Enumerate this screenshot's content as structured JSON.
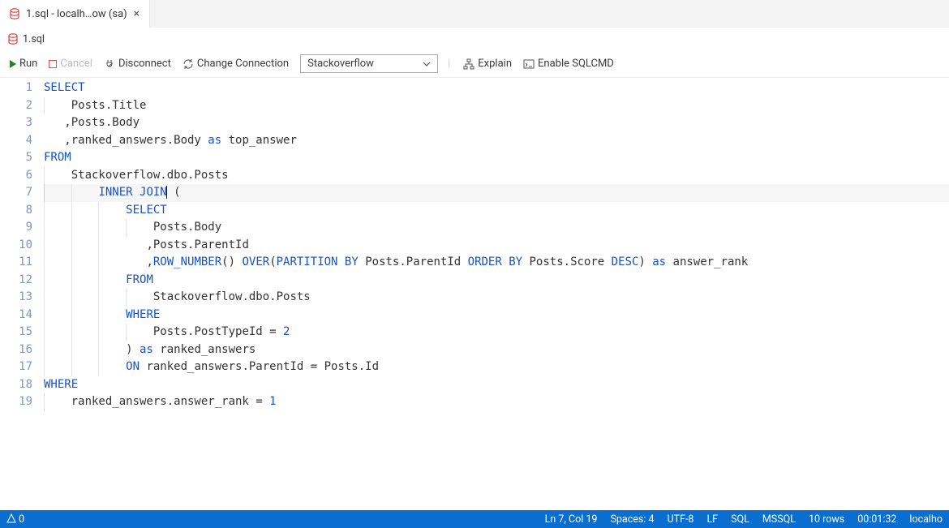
{
  "tab": {
    "title": "1.sql - localh…ow (sa)",
    "close": "×"
  },
  "subtab": {
    "title": "1.sql"
  },
  "toolbar": {
    "run": "Run",
    "cancel": "Cancel",
    "disconnect": "Disconnect",
    "change_conn": "Change Connection",
    "db_selected": "Stackoverflow",
    "explain": "Explain",
    "sqlcmd": "Enable SQLCMD"
  },
  "code": {
    "lines": [
      {
        "n": "1",
        "segs": [
          [
            "kw",
            "SELECT"
          ]
        ]
      },
      {
        "n": "2",
        "segs": [
          [
            "plain",
            "    Posts.Title"
          ]
        ]
      },
      {
        "n": "3",
        "segs": [
          [
            "plain",
            "   ,Posts.Body"
          ]
        ]
      },
      {
        "n": "4",
        "segs": [
          [
            "plain",
            "   ,ranked_answers.Body "
          ],
          [
            "kw",
            "as"
          ],
          [
            "plain",
            " top_answer"
          ]
        ]
      },
      {
        "n": "5",
        "segs": [
          [
            "kw",
            "FROM"
          ]
        ]
      },
      {
        "n": "6",
        "segs": [
          [
            "plain",
            "    Stackoverflow.dbo.Posts"
          ]
        ]
      },
      {
        "n": "7",
        "segs": [
          [
            "plain",
            "        "
          ],
          [
            "kw",
            "INNER JOIN"
          ],
          [
            "plain",
            " ("
          ]
        ],
        "current": true,
        "cursor_after": 2
      },
      {
        "n": "8",
        "segs": [
          [
            "plain",
            "            "
          ],
          [
            "kw",
            "SELECT"
          ]
        ]
      },
      {
        "n": "9",
        "segs": [
          [
            "plain",
            "                Posts.Body"
          ]
        ]
      },
      {
        "n": "10",
        "segs": [
          [
            "plain",
            "               ,Posts.ParentId"
          ]
        ]
      },
      {
        "n": "11",
        "segs": [
          [
            "plain",
            "               ,"
          ],
          [
            "kw",
            "ROW_NUMBER"
          ],
          [
            "plain",
            "() "
          ],
          [
            "kw",
            "OVER"
          ],
          [
            "plain",
            "("
          ],
          [
            "kw",
            "PARTITION BY"
          ],
          [
            "plain",
            " Posts.ParentId "
          ],
          [
            "kw",
            "ORDER BY"
          ],
          [
            "plain",
            " Posts.Score "
          ],
          [
            "kw",
            "DESC"
          ],
          [
            "plain",
            ") "
          ],
          [
            "kw",
            "as"
          ],
          [
            "plain",
            " answer_rank"
          ]
        ]
      },
      {
        "n": "12",
        "segs": [
          [
            "plain",
            "            "
          ],
          [
            "kw",
            "FROM"
          ]
        ]
      },
      {
        "n": "13",
        "segs": [
          [
            "plain",
            "                Stackoverflow.dbo.Posts"
          ]
        ]
      },
      {
        "n": "14",
        "segs": [
          [
            "plain",
            "            "
          ],
          [
            "kw",
            "WHERE"
          ]
        ]
      },
      {
        "n": "15",
        "segs": [
          [
            "plain",
            "                Posts.PostTypeId = "
          ],
          [
            "num",
            "2"
          ]
        ]
      },
      {
        "n": "16",
        "segs": [
          [
            "plain",
            "            ) "
          ],
          [
            "kw",
            "as"
          ],
          [
            "plain",
            " ranked_answers"
          ]
        ]
      },
      {
        "n": "17",
        "segs": [
          [
            "plain",
            "            "
          ],
          [
            "kw",
            "ON"
          ],
          [
            "plain",
            " ranked_answers.ParentId = Posts.Id"
          ]
        ]
      },
      {
        "n": "18",
        "segs": [
          [
            "kw",
            "WHERE"
          ]
        ]
      },
      {
        "n": "19",
        "segs": [
          [
            "plain",
            "    ranked_answers.answer_rank = "
          ],
          [
            "num",
            "1"
          ]
        ]
      }
    ]
  },
  "status": {
    "problems": "0",
    "lncol": "Ln 7, Col 19",
    "spaces": "Spaces: 4",
    "encoding": "UTF-8",
    "eol": "LF",
    "lang": "SQL",
    "provider": "MSSQL",
    "rows": "10 rows",
    "time": "00:01:32",
    "host": "localho"
  }
}
